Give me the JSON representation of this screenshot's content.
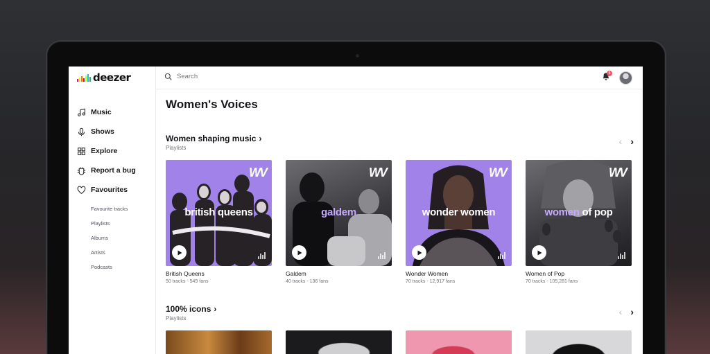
{
  "app": {
    "logo": "deezer"
  },
  "sidebar": {
    "items": [
      {
        "label": "Music",
        "icon": "music-note-icon"
      },
      {
        "label": "Shows",
        "icon": "microphone-icon"
      },
      {
        "label": "Explore",
        "icon": "grid-icon"
      },
      {
        "label": "Report a bug",
        "icon": "bug-icon"
      },
      {
        "label": "Favourites",
        "icon": "heart-icon"
      }
    ],
    "favourites_sub": [
      "Favourite tracks",
      "Playlists",
      "Albums",
      "Artists",
      "Podcasts"
    ]
  },
  "topbar": {
    "search_placeholder": "Search",
    "notification_count": "5"
  },
  "main": {
    "page_title": "Women's Voices",
    "sections": [
      {
        "title": "Women shaping music",
        "subtitle": "Playlists",
        "cards": [
          {
            "title": "British Queens",
            "meta": "50 tracks - 549 fans",
            "cover_text": "british queens",
            "cover_style": "purple"
          },
          {
            "title": "Galdem",
            "meta": "40 tracks - 136 fans",
            "cover_text": "galdem",
            "cover_style": "bw"
          },
          {
            "title": "Wonder Women",
            "meta": "70 tracks - 12,917 fans",
            "cover_text": "wonder women",
            "cover_style": "purple"
          },
          {
            "title": "Women of Pop",
            "meta": "70 tracks - 105,281 fans",
            "cover_text_a": "women",
            "cover_text_b": " of pop",
            "cover_style": "bw"
          }
        ]
      },
      {
        "title": "100% icons",
        "subtitle": "Playlists"
      }
    ],
    "cover_logo": "WV"
  },
  "colors": {
    "accent_purple": "#a182e8",
    "logo_bars": [
      "#ff0092",
      "#ffed00",
      "#ff7000",
      "#ff0000",
      "#c2ff00",
      "#00c7f2",
      "#29ab70"
    ]
  }
}
